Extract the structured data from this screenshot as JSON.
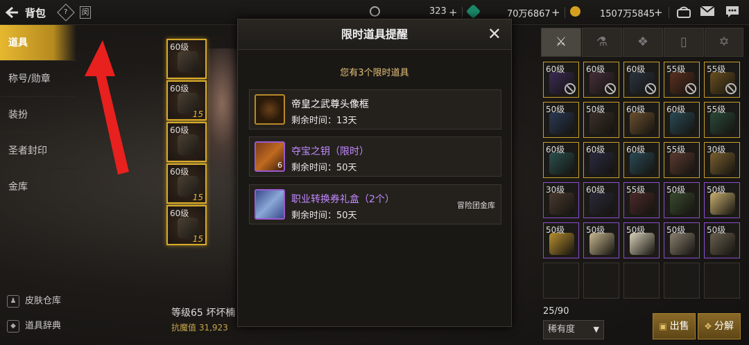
{
  "topbar": {
    "title": "背包",
    "help_icon": "?",
    "book_icon": "闵",
    "currency1_value": "323",
    "currency2_value": "70万6867",
    "currency3_value": "1507万5845",
    "plus": "+",
    "icons": [
      "crescent-coin-icon",
      "green-gem-icon",
      "gold-coin-icon",
      "treasure-chest-icon",
      "mail-icon",
      "chat-icon"
    ]
  },
  "sidebar": {
    "items": [
      {
        "label": "道具"
      },
      {
        "label": "称号/勋章"
      },
      {
        "label": "装扮"
      },
      {
        "label": "圣者封印"
      },
      {
        "label": "金库"
      }
    ],
    "bottom": [
      {
        "label": "皮肤仓库"
      },
      {
        "label": "道具辞典"
      }
    ]
  },
  "equip_slots": [
    {
      "level": "60级",
      "quality": ""
    },
    {
      "level": "60级",
      "quality": "15"
    },
    {
      "level": "60级",
      "quality": ""
    },
    {
      "level": "60级",
      "quality": "15"
    },
    {
      "level": "60级",
      "quality": "15"
    }
  ],
  "character": {
    "name_line": "等级65 坏坏楠",
    "stat_line": "抗魔值 31,923"
  },
  "modal": {
    "title": "限时道具提醒",
    "close": "✕",
    "subtitle": "您有3个限时道具",
    "items": [
      {
        "name": "帝皇之武尊头像框",
        "time": "剩余时间：13天",
        "count": "",
        "tag": ""
      },
      {
        "name": "夺宝之钥（限时）",
        "time": "剩余时间：50天",
        "count": "6",
        "tag": ""
      },
      {
        "name": "职业转换券礼盒（2个）",
        "time": "剩余时间：50天",
        "count": "",
        "tag": "冒险团金库"
      }
    ]
  },
  "inventory": {
    "tabs": [
      "equipment-icon",
      "potion-icon",
      "material-icon",
      "card-icon",
      "pentagram-icon"
    ],
    "slots": [
      {
        "level": "60级",
        "rarity": "gold",
        "banned": true,
        "color": "#3b2b55"
      },
      {
        "level": "60级",
        "rarity": "gold",
        "banned": true,
        "color": "#452f3a"
      },
      {
        "level": "60级",
        "rarity": "gold",
        "banned": true,
        "color": "#2a3440"
      },
      {
        "level": "55级",
        "rarity": "gold",
        "banned": true,
        "color": "#5a3020"
      },
      {
        "level": "55级",
        "rarity": "gold",
        "banned": true,
        "color": "#6a5020"
      },
      {
        "level": "50级",
        "rarity": "gold",
        "banned": false,
        "color": "#2a3a55"
      },
      {
        "level": "50级",
        "rarity": "gold",
        "banned": false,
        "color": "#3a3028"
      },
      {
        "level": "60级",
        "rarity": "gold",
        "banned": false,
        "color": "#6a5030"
      },
      {
        "level": "60级",
        "rarity": "gold",
        "banned": false,
        "color": "#2a4a55"
      },
      {
        "level": "55级",
        "rarity": "gold",
        "banned": false,
        "color": "#2a4a3a"
      },
      {
        "level": "60级",
        "rarity": "gold",
        "banned": false,
        "color": "#2a5050"
      },
      {
        "level": "60级",
        "rarity": "gold",
        "banned": false,
        "color": "#2a2a40"
      },
      {
        "level": "60级",
        "rarity": "gold",
        "banned": false,
        "color": "#2a4a55"
      },
      {
        "level": "55级",
        "rarity": "gold",
        "banned": false,
        "color": "#5a3a30"
      },
      {
        "level": "30级",
        "rarity": "gold",
        "banned": false,
        "color": "#7a6030"
      },
      {
        "level": "30级",
        "rarity": "purple",
        "banned": false,
        "color": "#4a3a30"
      },
      {
        "level": "60级",
        "rarity": "purple",
        "banned": false,
        "color": "#2a2a3a"
      },
      {
        "level": "55级",
        "rarity": "purple",
        "banned": false,
        "color": "#4a2a2a"
      },
      {
        "level": "50级",
        "rarity": "purple",
        "banned": false,
        "color": "#3a4a30"
      },
      {
        "level": "50级",
        "rarity": "purple",
        "banned": false,
        "color": "#c8b070"
      },
      {
        "level": "50级",
        "rarity": "purple",
        "banned": false,
        "color": "#b89030"
      },
      {
        "level": "50级",
        "rarity": "purple",
        "banned": false,
        "color": "#c8b890"
      },
      {
        "level": "50级",
        "rarity": "purple",
        "banned": false,
        "color": "#d8d0b8"
      },
      {
        "level": "50级",
        "rarity": "purple",
        "banned": false,
        "color": "#8a8070"
      },
      {
        "level": "50级",
        "rarity": "purple",
        "banned": false,
        "color": "#6a6050"
      },
      {
        "level": "",
        "rarity": "none",
        "banned": false,
        "color": ""
      },
      {
        "level": "",
        "rarity": "none",
        "banned": false,
        "color": ""
      },
      {
        "level": "",
        "rarity": "none",
        "banned": false,
        "color": ""
      },
      {
        "level": "",
        "rarity": "none",
        "banned": false,
        "color": ""
      },
      {
        "level": "",
        "rarity": "none",
        "banned": false,
        "color": ""
      }
    ],
    "capacity": "25/90",
    "sort_label": "稀有度",
    "sort_dd": "▼",
    "sell_label": "出售",
    "decompose_label": "分解"
  }
}
